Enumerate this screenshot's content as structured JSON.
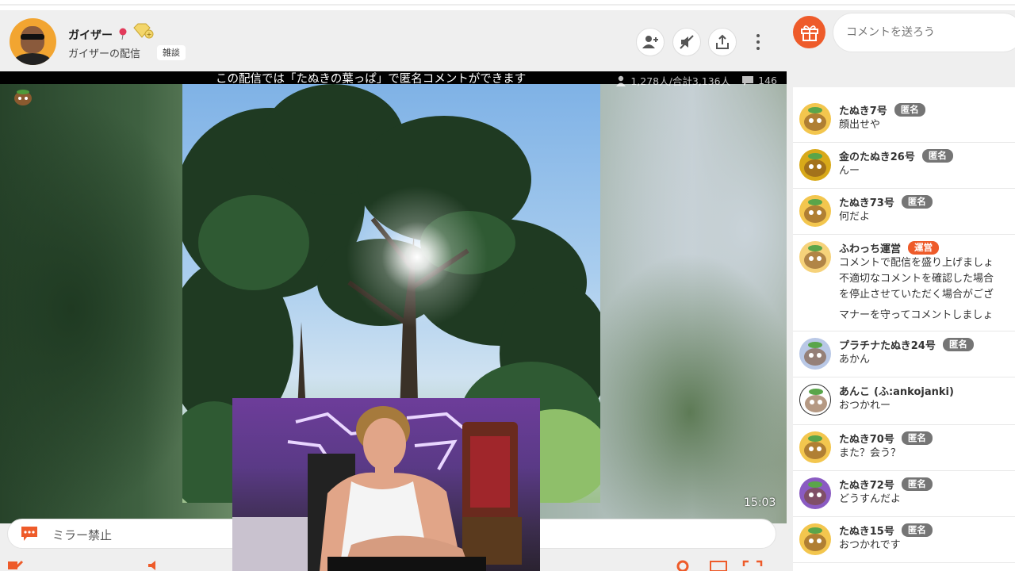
{
  "header": {
    "channel_name": "ガイザー",
    "channel_subtitle": "ガイザーの配信",
    "category": "雑談",
    "buttons": [
      "follow-user-icon",
      "mute-icon",
      "share-icon",
      "more-icon"
    ]
  },
  "video": {
    "notice": "この配信では「たぬきの葉っぱ」で匿名コメントができます",
    "viewers": "1,278人/合計3,136人",
    "comments_count": "146",
    "timecode": "15:03"
  },
  "comment_bar": {
    "text": "ミラー禁止"
  },
  "right": {
    "comment_placeholder": "コメントを送ろう"
  },
  "comments": [
    {
      "name": "たぬき7号",
      "tag": "匿名",
      "text": [
        "顔出せや"
      ],
      "avatar_color": "#f3c64e"
    },
    {
      "name": "金のたぬき26号",
      "tag": "匿名",
      "text": [
        "んー"
      ],
      "avatar_color": "#d8a919"
    },
    {
      "name": "たぬき73号",
      "tag": "匿名",
      "text": [
        "何だよ"
      ],
      "avatar_color": "#f3c64e"
    },
    {
      "name": "ふわっち運営",
      "tag": "運営",
      "text": [
        "コメントで配信を盛り上げましょ",
        "不適切なコメントを確認した場合",
        "を停止させていただく場合がござ",
        "マナーを守ってコメントしましょ"
      ],
      "avatar_color": "#f6d27a"
    },
    {
      "name": "プラチナたぬき24号",
      "tag": "匿名",
      "text": [
        "あかん"
      ],
      "avatar_color": "#b9c8e6"
    },
    {
      "name": "あんこ",
      "tag": "",
      "suffix": "(ふ:ankojanki)",
      "text": [
        "おつかれー"
      ],
      "avatar_color": "#ffffff"
    },
    {
      "name": "たぬき70号",
      "tag": "匿名",
      "text": [
        "また？会う？"
      ],
      "avatar_color": "#f3c64e"
    },
    {
      "name": "たぬき72号",
      "tag": "匿名",
      "text": [
        "どうすんだよ"
      ],
      "avatar_color": "#8a5bc2"
    },
    {
      "name": "たぬき15号",
      "tag": "匿名",
      "text": [
        "おつかれです"
      ],
      "avatar_color": "#f3c64e"
    }
  ],
  "colors": {
    "accent": "#ee5b2a",
    "anon_tag": "#757575",
    "panel_bg": "#efefef"
  }
}
